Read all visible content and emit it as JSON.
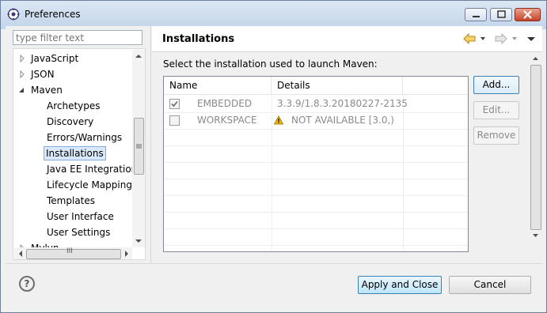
{
  "window": {
    "title": "Preferences"
  },
  "filter": {
    "placeholder": "type filter text"
  },
  "tree": {
    "items": [
      {
        "label": "JavaScript",
        "expander": "collapsed"
      },
      {
        "label": "JSON",
        "expander": "collapsed"
      },
      {
        "label": "Maven",
        "expander": "expanded"
      },
      {
        "label": "Archetypes"
      },
      {
        "label": "Discovery"
      },
      {
        "label": "Errors/Warnings"
      },
      {
        "label": "Installations",
        "selected": true
      },
      {
        "label": "Java EE Integration"
      },
      {
        "label": "Lifecycle Mappings"
      },
      {
        "label": "Templates"
      },
      {
        "label": "User Interface"
      },
      {
        "label": "User Settings"
      },
      {
        "label": "Mylyn",
        "expander": "collapsed"
      }
    ],
    "hscroll_grip": "III"
  },
  "page": {
    "title": "Installations",
    "instruction": "Select the installation used to launch Maven:",
    "table": {
      "columns": [
        "Name",
        "Details"
      ],
      "rows": [
        {
          "checked": true,
          "name": "EMBEDDED",
          "details": "3.3.9/1.8.3.20180227-2135",
          "warning": false
        },
        {
          "checked": false,
          "name": "WORKSPACE",
          "details": "NOT AVAILABLE [3.0,)",
          "warning": true
        }
      ]
    },
    "buttons": {
      "add": "Add...",
      "edit": "Edit...",
      "remove": "Remove"
    }
  },
  "footer": {
    "help_symbol": "?",
    "apply_close": "Apply and Close",
    "cancel": "Cancel"
  },
  "colors": {
    "selection": "#d9e8fb",
    "accent": "#3c7fb1",
    "warning": "#f2b705"
  }
}
